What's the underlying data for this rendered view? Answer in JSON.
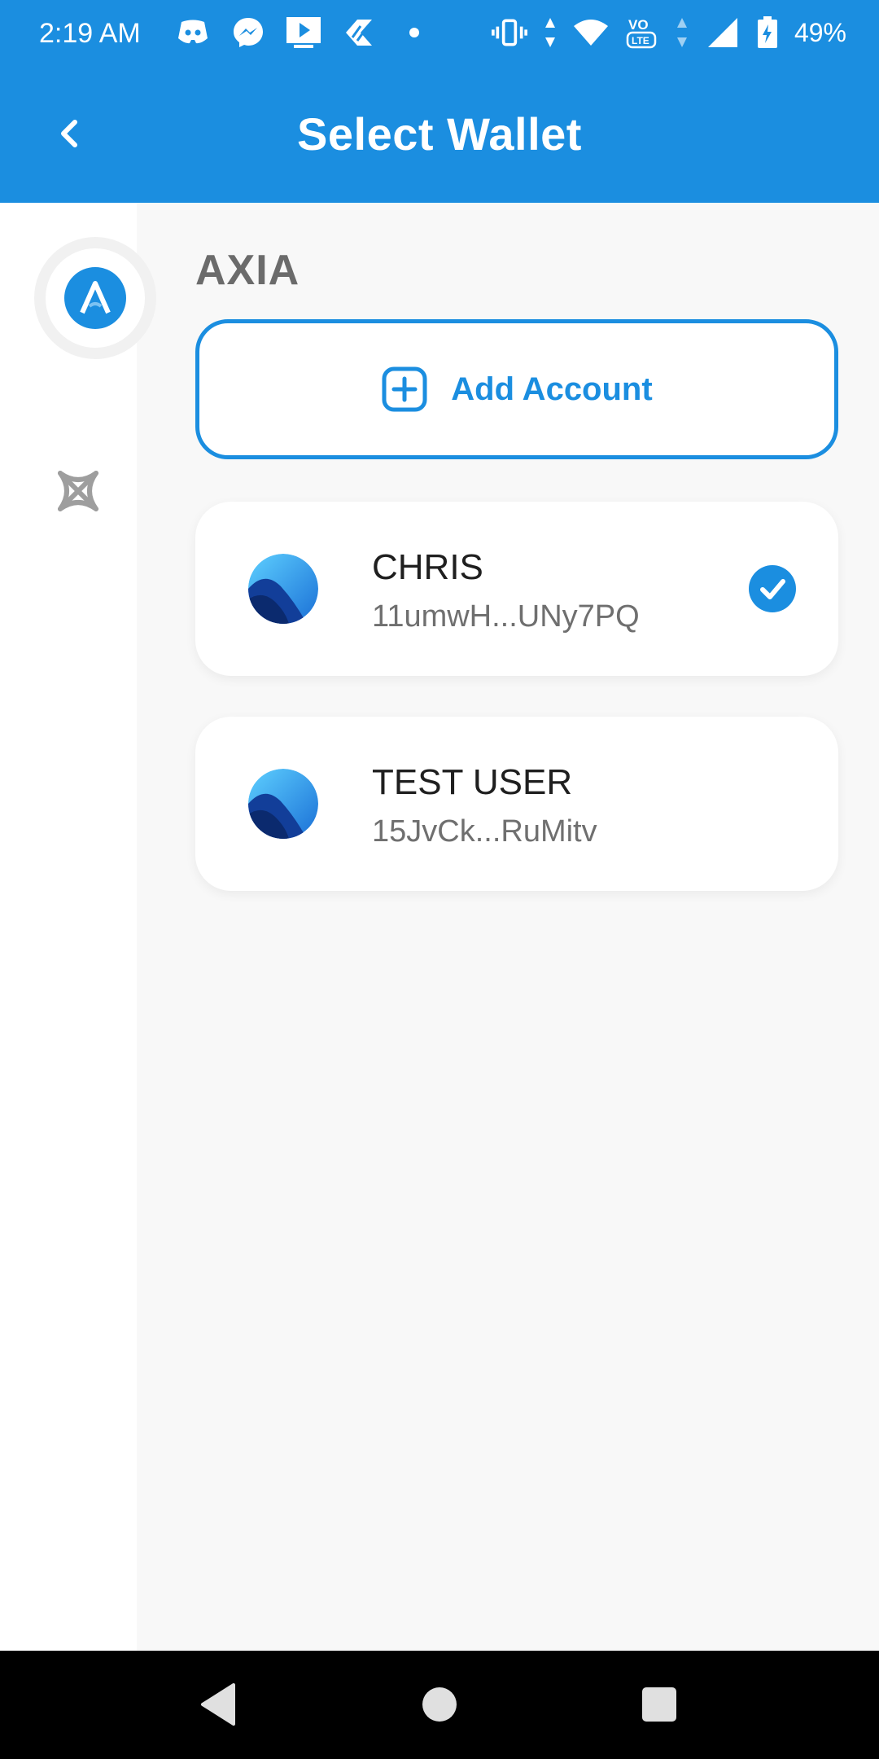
{
  "status_bar": {
    "time": "2:19 AM",
    "battery": "49%",
    "icons_left": [
      "discord-icon",
      "messenger-icon",
      "video-player-icon",
      "app-icon",
      "dot-icon"
    ],
    "icons_right": [
      "vibrate-icon",
      "data-arrows-icon",
      "wifi-icon",
      "volte-icon",
      "signal-icon",
      "battery-icon"
    ]
  },
  "header": {
    "title": "Select Wallet",
    "back_icon": "chevron-left-icon"
  },
  "sidebar": {
    "items": [
      {
        "name": "axia",
        "icon": "axia-logo-icon",
        "active": true
      },
      {
        "name": "other-network",
        "icon": "network-logo-icon",
        "active": false
      }
    ]
  },
  "main": {
    "network_title": "AXIA",
    "add_account_label": "Add Account",
    "accounts": [
      {
        "name": "CHRIS",
        "address": "11umwH...UNy7PQ",
        "selected": true
      },
      {
        "name": "TEST USER",
        "address": "15JvCk...RuMitv",
        "selected": false
      }
    ]
  },
  "colors": {
    "accent": "#1b8ee0",
    "background": "#f8f8f8",
    "sidebar": "#ffffff"
  },
  "nav_bar": {
    "items": [
      "nav-back-icon",
      "nav-home-icon",
      "nav-recents-icon"
    ]
  }
}
